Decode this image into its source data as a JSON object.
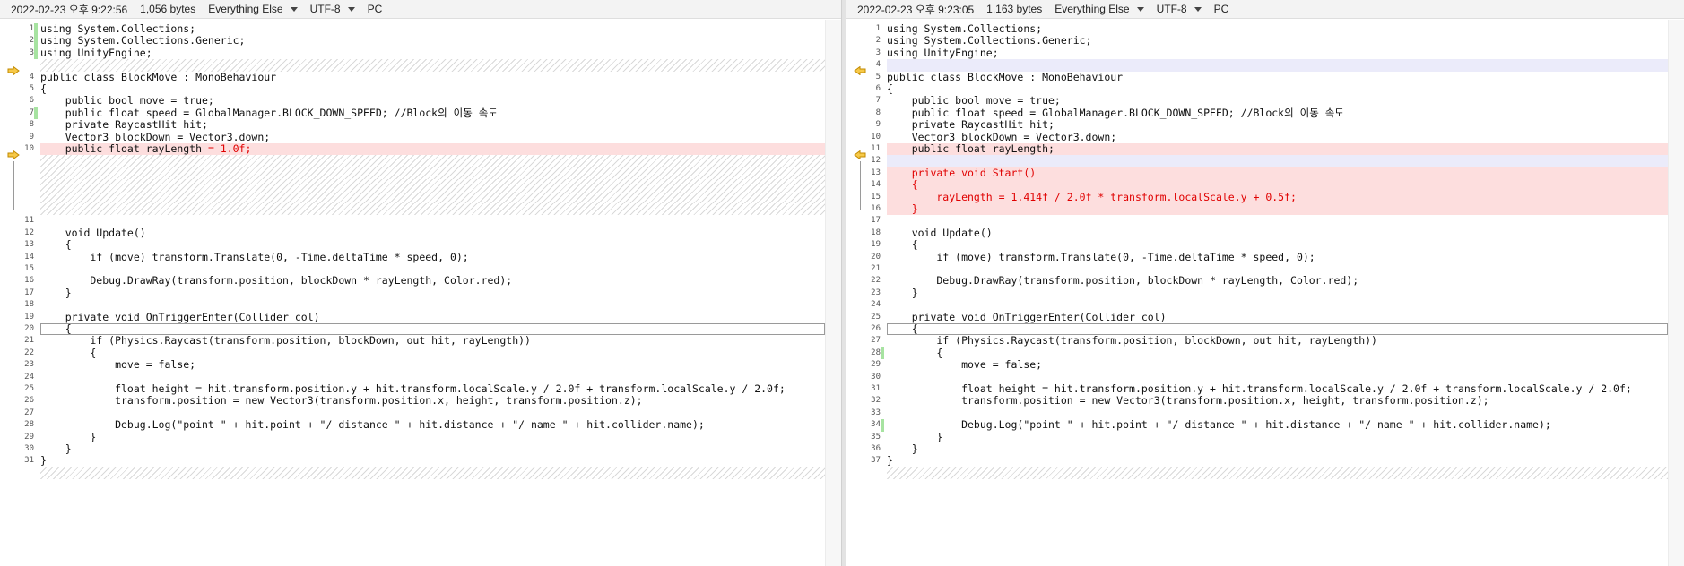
{
  "left": {
    "date": "2022-02-23 오후 9:22:56",
    "size": "1,056 bytes",
    "filter": "Everything Else",
    "encoding": "UTF-8",
    "lineending": "PC"
  },
  "right": {
    "date": "2022-02-23 오후 9:23:05",
    "size": "1,163 bytes",
    "filter": "Everything Else",
    "encoding": "UTF-8",
    "lineending": "PC"
  },
  "left_lines": [
    {
      "n": "1",
      "t": "using System.Collections;",
      "mod": true
    },
    {
      "n": "2",
      "t": "using System.Collections.Generic;",
      "mod": true
    },
    {
      "n": "3",
      "t": "using UnityEngine;",
      "mod": true
    },
    {
      "n": "",
      "t": "",
      "hatch": true,
      "arrow": true
    },
    {
      "n": "4",
      "t": "public class BlockMove : MonoBehaviour"
    },
    {
      "n": "5",
      "t": "{"
    },
    {
      "n": "6",
      "t": "    public bool move = true;"
    },
    {
      "n": "7",
      "t": "    public float speed = GlobalManager.BLOCK_DOWN_SPEED; //Block의 이동 속도",
      "mod": true
    },
    {
      "n": "8",
      "t": "    private RaycastHit hit;"
    },
    {
      "n": "9",
      "t": "    Vector3 blockDown = Vector3.down;"
    },
    {
      "n": "10",
      "t": "    public float rayLength",
      "tail": " = 1.0f;",
      "red": true,
      "arrow": true
    },
    {
      "n": "",
      "t": "",
      "hatch": true,
      "bracket": "top"
    },
    {
      "n": "",
      "t": "",
      "hatch": true,
      "bracket": "mid"
    },
    {
      "n": "",
      "t": "",
      "hatch": true,
      "bracket": "mid"
    },
    {
      "n": "",
      "t": "",
      "hatch": true,
      "bracket": "mid"
    },
    {
      "n": "",
      "t": "",
      "hatch": true,
      "bracket": "bot"
    },
    {
      "n": "11",
      "t": ""
    },
    {
      "n": "12",
      "t": "    void Update()"
    },
    {
      "n": "13",
      "t": "    {"
    },
    {
      "n": "14",
      "t": "        if (move) transform.Translate(0, -Time.deltaTime * speed, 0);"
    },
    {
      "n": "15",
      "t": ""
    },
    {
      "n": "16",
      "t": "        Debug.DrawRay(transform.position, blockDown * rayLength, Color.red);"
    },
    {
      "n": "17",
      "t": "    }"
    },
    {
      "n": "18",
      "t": ""
    },
    {
      "n": "19",
      "t": "    private void OnTriggerEnter(Collider col)"
    },
    {
      "n": "20",
      "t": "    {",
      "cursor": true
    },
    {
      "n": "21",
      "t": "        if (Physics.Raycast(transform.position, blockDown, out hit, rayLength))"
    },
    {
      "n": "22",
      "t": "        {"
    },
    {
      "n": "23",
      "t": "            move = false;"
    },
    {
      "n": "24",
      "t": ""
    },
    {
      "n": "25",
      "t": "            float height = hit.transform.position.y + hit.transform.localScale.y / 2.0f + transform.localScale.y / 2.0f;"
    },
    {
      "n": "26",
      "t": "            transform.position = new Vector3(transform.position.x, height, transform.position.z);"
    },
    {
      "n": "27",
      "t": ""
    },
    {
      "n": "28",
      "t": "            Debug.Log(\"point \" + hit.point + \"/ distance \" + hit.distance + \"/ name \" + hit.collider.name);"
    },
    {
      "n": "29",
      "t": "        }"
    },
    {
      "n": "30",
      "t": "    }"
    },
    {
      "n": "31",
      "t": "}"
    },
    {
      "n": "",
      "t": "",
      "hatch": true
    }
  ],
  "right_lines": [
    {
      "n": "1",
      "t": "using System.Collections;"
    },
    {
      "n": "2",
      "t": "using System.Collections.Generic;"
    },
    {
      "n": "3",
      "t": "using UnityEngine;"
    },
    {
      "n": "4",
      "t": "",
      "blue": true,
      "arrow": true
    },
    {
      "n": "5",
      "t": "public class BlockMove : MonoBehaviour"
    },
    {
      "n": "6",
      "t": "{"
    },
    {
      "n": "7",
      "t": "    public bool move = true;"
    },
    {
      "n": "8",
      "t": "    public float speed = GlobalManager.BLOCK_DOWN_SPEED; //Block의 이동 속도"
    },
    {
      "n": "9",
      "t": "    private RaycastHit hit;"
    },
    {
      "n": "10",
      "t": "    Vector3 blockDown = Vector3.down;"
    },
    {
      "n": "11",
      "t": "    public float rayLength;",
      "red": true,
      "arrow": true
    },
    {
      "n": "12",
      "t": "",
      "blue": true,
      "bracket": "top"
    },
    {
      "n": "13",
      "t": "    private void Start()",
      "red": true,
      "redtxt": true,
      "bracket": "mid"
    },
    {
      "n": "14",
      "t": "    {",
      "red": true,
      "redtxt": true,
      "bracket": "mid"
    },
    {
      "n": "15",
      "t": "        rayLength = 1.414f / 2.0f * transform.localScale.y + 0.5f;",
      "red": true,
      "redtxt": true,
      "bracket": "mid"
    },
    {
      "n": "16",
      "t": "    }",
      "red": true,
      "redtxt": true,
      "bracket": "bot"
    },
    {
      "n": "17",
      "t": ""
    },
    {
      "n": "18",
      "t": "    void Update()"
    },
    {
      "n": "19",
      "t": "    {"
    },
    {
      "n": "20",
      "t": "        if (move) transform.Translate(0, -Time.deltaTime * speed, 0);"
    },
    {
      "n": "21",
      "t": ""
    },
    {
      "n": "22",
      "t": "        Debug.DrawRay(transform.position, blockDown * rayLength, Color.red);"
    },
    {
      "n": "23",
      "t": "    }"
    },
    {
      "n": "24",
      "t": ""
    },
    {
      "n": "25",
      "t": "    private void OnTriggerEnter(Collider col)"
    },
    {
      "n": "26",
      "t": "    {",
      "cursor": true
    },
    {
      "n": "27",
      "t": "        if (Physics.Raycast(transform.position, blockDown, out hit, rayLength))"
    },
    {
      "n": "28",
      "t": "        {",
      "mod": true
    },
    {
      "n": "29",
      "t": "            move = false;"
    },
    {
      "n": "30",
      "t": ""
    },
    {
      "n": "31",
      "t": "            float height = hit.transform.position.y + hit.transform.localScale.y / 2.0f + transform.localScale.y / 2.0f;"
    },
    {
      "n": "32",
      "t": "            transform.position = new Vector3(transform.position.x, height, transform.position.z);"
    },
    {
      "n": "33",
      "t": ""
    },
    {
      "n": "34",
      "t": "            Debug.Log(\"point \" + hit.point + \"/ distance \" + hit.distance + \"/ name \" + hit.collider.name);",
      "mod": true
    },
    {
      "n": "35",
      "t": "        }"
    },
    {
      "n": "36",
      "t": "    }"
    },
    {
      "n": "37",
      "t": "}"
    },
    {
      "n": "",
      "t": "",
      "hatch": true
    }
  ],
  "icons": {
    "diff_arrow": "diff-arrow-icon",
    "dropdown": "chevron-down-icon"
  }
}
